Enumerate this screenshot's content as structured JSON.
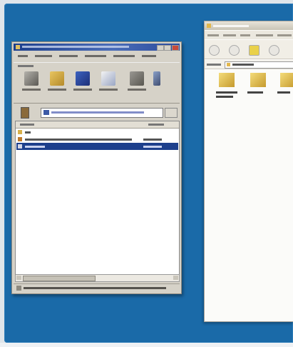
{
  "desktop": {
    "background_color": "#1a6aa8"
  },
  "archiver_window": {
    "icon": "archive-app-icon",
    "toolbar_icons": [
      "add-icon",
      "extract-icon",
      "test-icon",
      "view-icon",
      "delete-icon",
      "find-icon"
    ],
    "columns": [],
    "rows": [
      {
        "icon": "parent-folder-icon",
        "selected": false
      },
      {
        "icon": "archive-file-icon",
        "selected": false
      },
      {
        "icon": "file-icon",
        "selected": true
      }
    ]
  },
  "explorer_window": {
    "folders": [
      {
        "icon": "folder-icon"
      },
      {
        "icon": "folder-icon"
      },
      {
        "icon": "folder-icon"
      }
    ]
  }
}
